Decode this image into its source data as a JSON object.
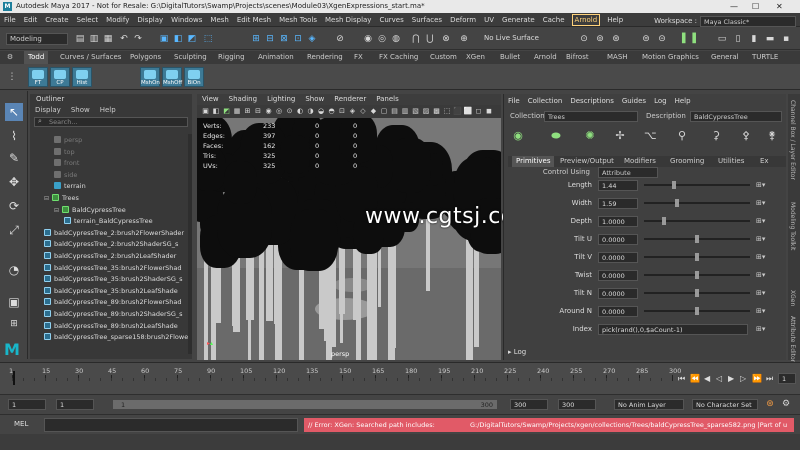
{
  "window": {
    "title": "Autodesk Maya 2017 - Not for Resale: G:\\DigitalTutors\\Swamp\\Projects\\scenes\\Module03\\XgenExpressions_start.ma*",
    "app_icon": "M",
    "minimize": "—",
    "maximize": "☐",
    "close": "✕"
  },
  "menubar": {
    "items": [
      "File",
      "Edit",
      "Create",
      "Select",
      "Modify",
      "Display",
      "Windows",
      "Mesh",
      "Edit Mesh",
      "Mesh Tools",
      "Mesh Display",
      "Curves",
      "Surfaces",
      "Deform",
      "UV",
      "Generate",
      "Cache"
    ],
    "arnold": "Arnold",
    "help": "Help",
    "workspace_label": "Workspace :",
    "workspace_value": "Maya Classic*"
  },
  "statusline": {
    "mode": "Modeling",
    "live_surface": "No Live Surface"
  },
  "shelf": {
    "tabs": [
      "Todd",
      "Curves / Surfaces",
      "Polygons",
      "Sculpting",
      "Rigging",
      "Animation",
      "Rendering",
      "FX",
      "FX Caching",
      "Custom",
      "XGen",
      "Bullet",
      "Arnold",
      "Bifrost",
      "MASH",
      "Motion Graphics",
      "General",
      "TURTLE"
    ],
    "buttons": [
      "FT",
      "CP",
      "Hist",
      "MshOn",
      "MshOff",
      "BiOn"
    ]
  },
  "outliner": {
    "title": "Outliner",
    "menu": [
      "Display",
      "Show",
      "Help"
    ],
    "search_placeholder": "Search...",
    "items": [
      {
        "label": "persp",
        "kind": "cam",
        "dim": true,
        "indent": 2
      },
      {
        "label": "top",
        "kind": "cam",
        "dim": true,
        "indent": 2
      },
      {
        "label": "front",
        "kind": "cam",
        "dim": true,
        "indent": 2
      },
      {
        "label": "side",
        "kind": "cam",
        "dim": true,
        "indent": 2
      },
      {
        "label": "terrain",
        "kind": "mesh",
        "dim": false,
        "indent": 2
      },
      {
        "label": "Trees",
        "kind": "grp",
        "dim": false,
        "indent": 1
      },
      {
        "label": "BaldCypressTree",
        "kind": "grp",
        "dim": false,
        "indent": 2
      },
      {
        "label": "terrain_BaldCypressTree",
        "kind": "mat",
        "dim": false,
        "indent": 3
      },
      {
        "label": "baldCypressTree_2:brush2FlowerShader",
        "kind": "mat",
        "dim": false,
        "indent": 1
      },
      {
        "label": "baldCypressTree_2:brush2ShaderSG_s",
        "kind": "mat",
        "dim": false,
        "indent": 1
      },
      {
        "label": "baldCypressTree_2:brush2LeafShader",
        "kind": "mat",
        "dim": false,
        "indent": 1
      },
      {
        "label": "baldCypressTree_35:brush2FlowerShad",
        "kind": "mat",
        "dim": false,
        "indent": 1
      },
      {
        "label": "baldCypressTree_35:brush2ShaderSG_s",
        "kind": "mat",
        "dim": false,
        "indent": 1
      },
      {
        "label": "baldCypressTree_35:brush2LeafShade",
        "kind": "mat",
        "dim": false,
        "indent": 1
      },
      {
        "label": "baldCypressTree_89:brush2FlowerShad",
        "kind": "mat",
        "dim": false,
        "indent": 1
      },
      {
        "label": "baldCypressTree_89:brush2ShaderSG_s",
        "kind": "mat",
        "dim": false,
        "indent": 1
      },
      {
        "label": "baldCypressTree_89:brush2LeafShade",
        "kind": "mat",
        "dim": false,
        "indent": 1
      },
      {
        "label": "baldCypressTree_sparse158:brush2FlowerS",
        "kind": "mat",
        "dim": false,
        "indent": 1
      }
    ]
  },
  "viewport": {
    "menu": [
      "View",
      "Shading",
      "Lighting",
      "Show",
      "Renderer",
      "Panels"
    ],
    "hud": [
      {
        "label": "Verts:",
        "v1": "233",
        "v2": "0",
        "v3": "0"
      },
      {
        "label": "Edges:",
        "v1": "397",
        "v2": "0",
        "v3": "0"
      },
      {
        "label": "Faces:",
        "v1": "162",
        "v2": "0",
        "v3": "0"
      },
      {
        "label": "Tris:",
        "v1": "325",
        "v2": "0",
        "v3": "0"
      },
      {
        "label": "UVs:",
        "v1": "325",
        "v2": "0",
        "v3": "0"
      }
    ],
    "camera": "persp"
  },
  "watermark": "www.cgtsj.com",
  "xgen": {
    "menu": [
      "File",
      "Collection",
      "Descriptions",
      "Guides",
      "Log",
      "Help"
    ],
    "collection_label": "Collection",
    "collection_value": "Trees",
    "description_label": "Description",
    "description_value": "BaldCypressTree",
    "tabs": [
      "Primitives",
      "Preview/Output",
      "Modifiers",
      "Grooming",
      "Utilities",
      "Ex"
    ],
    "control_using_label": "Control Using",
    "control_using_value": "Attribute",
    "params": [
      {
        "label": "Length",
        "value": "1.44",
        "pos": 0.27
      },
      {
        "label": "Width",
        "value": "1.59",
        "pos": 0.3
      },
      {
        "label": "Depth",
        "value": "1.0000",
        "pos": 0.18
      },
      {
        "label": "Tilt U",
        "value": "0.0000",
        "pos": 0.5
      },
      {
        "label": "Tilt V",
        "value": "0.0000",
        "pos": 0.5
      },
      {
        "label": "Twist",
        "value": "0.0000",
        "pos": 0.5
      },
      {
        "label": "Tilt N",
        "value": "0.0000",
        "pos": 0.5
      },
      {
        "label": "Around N",
        "value": "0.0000",
        "pos": 0.5
      }
    ],
    "index_label": "Index",
    "index_value": "pick(rand(),0,$aCount-1)",
    "log_label": "Log"
  },
  "side_tabs": [
    "Channel Box / Layer Editor",
    "Modeling Toolkit",
    "XGen",
    "Attribute Editor"
  ],
  "timeline": {
    "ticks": [
      "1",
      "15",
      "30",
      "45",
      "60",
      "75",
      "90",
      "105",
      "120",
      "135",
      "150",
      "165",
      "180",
      "195",
      "210",
      "225",
      "240",
      "255",
      "270",
      "285",
      "300"
    ],
    "current_frame": "1"
  },
  "range": {
    "start": "1",
    "playback_start": "1",
    "range_start": "1",
    "range_end": "300",
    "playback_end": "300",
    "end": "300",
    "anim_layer": "No Anim Layer",
    "character_set": "No Character Set"
  },
  "cmdline": {
    "label": "MEL",
    "error_text": "// Error: XGen:  Searched path includes:",
    "error_path": "G:/DigitalTutors/Swamp/Projects/xgen/collections/Trees/baldCypressTree_sparse582.png |Part of u"
  }
}
